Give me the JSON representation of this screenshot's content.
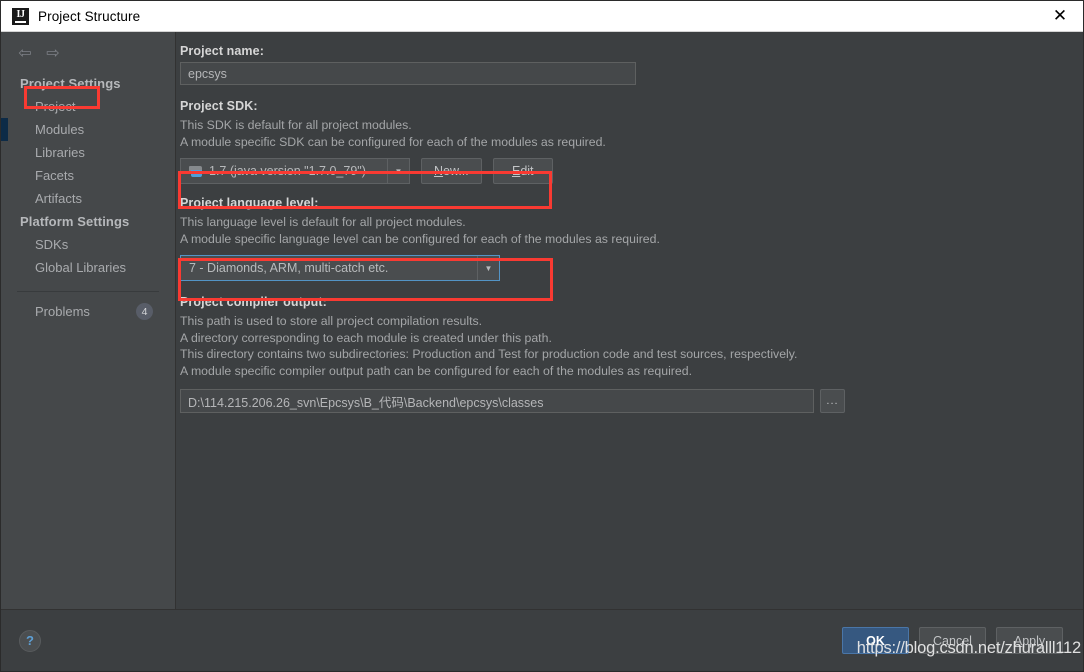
{
  "window": {
    "title": "Project Structure",
    "logo_text": "IJ",
    "close_label": "✕"
  },
  "sidebar": {
    "nav": {
      "back": "⇦",
      "forward": "⇨"
    },
    "groups": [
      {
        "title": "Project Settings",
        "items": [
          {
            "label": "Project",
            "selected": true
          },
          {
            "label": "Modules",
            "selected": false
          },
          {
            "label": "Libraries",
            "selected": false
          },
          {
            "label": "Facets",
            "selected": false
          },
          {
            "label": "Artifacts",
            "selected": false
          }
        ]
      },
      {
        "title": "Platform Settings",
        "items": [
          {
            "label": "SDKs",
            "selected": false
          },
          {
            "label": "Global Libraries",
            "selected": false
          }
        ]
      }
    ],
    "problems": {
      "label": "Problems",
      "count": "4"
    }
  },
  "main": {
    "project_name": {
      "title": "Project name:",
      "value": "epcsys"
    },
    "project_sdk": {
      "title": "Project SDK:",
      "desc1": "This SDK is default for all project modules.",
      "desc2": "A module specific SDK can be configured for each of the modules as required.",
      "value": "1.7 (java version \"1.7.0_79\")",
      "arrow": "▼",
      "new_button": "New...",
      "new_button_mnemonic": "N",
      "new_button_rest": "ew...",
      "edit_button": "Edit",
      "edit_button_mnemonic": "E",
      "edit_button_rest": "dit"
    },
    "language_level": {
      "title": "Project language level:",
      "desc1": "This language level is default for all project modules.",
      "desc2": "A module specific language level can be configured for each of the modules as required.",
      "value": "7 - Diamonds, ARM, multi-catch etc.",
      "arrow": "▼"
    },
    "compiler_output": {
      "title": "Project compiler output:",
      "desc1": "This path is used to store all project compilation results.",
      "desc2": "A directory corresponding to each module is created under this path.",
      "desc3": "This directory contains two subdirectories: Production and Test for production code and test sources, respectively.",
      "desc4": "A module specific compiler output path can be configured for each of the modules as required.",
      "value": "D:\\114.215.206.26_svn\\Epcsys\\B_代码\\Backend\\epcsys\\classes",
      "browse_label": "..."
    }
  },
  "footer": {
    "help_label": "?",
    "ok_label": "OK",
    "cancel_label": "Cancel",
    "apply_label": "Apply",
    "apply_mnemonic": "A",
    "apply_rest": "pply"
  },
  "watermark": "https://blog.csdn.net/zhuralll112",
  "colors": {
    "accent_blue": "#365880",
    "annotation_red": "#f93a32",
    "focus_blue": "#5394c6",
    "panel_bg": "#3c3f41",
    "sidebar_bg": "#45484a"
  }
}
